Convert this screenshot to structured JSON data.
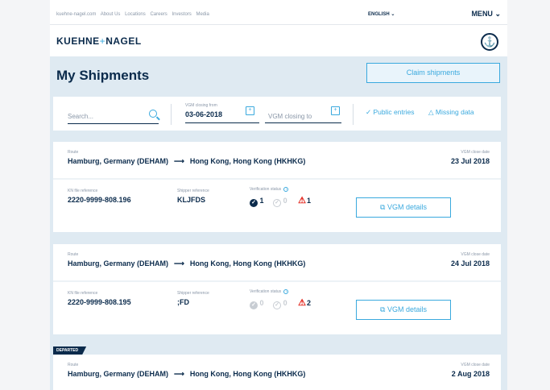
{
  "topbar": {
    "links": [
      "kuehne-nagel.com",
      "About Us",
      "Locations",
      "Careers",
      "Investors",
      "Media"
    ],
    "language": "ENGLISH",
    "menu": "MENU"
  },
  "brand": {
    "left": "KUEHNE",
    "plus": "+",
    "right": "NAGEL",
    "icon": "anchor-icon"
  },
  "page": {
    "title": "My Shipments",
    "claim_button": "Claim shipments"
  },
  "filters": {
    "search_placeholder": "Search...",
    "vgm_from_label": "VGM closing from",
    "vgm_from_value": "03-06-2018",
    "vgm_to_placeholder": "VGM closing to",
    "public_entries": "Public entries",
    "missing_data": "Missing data"
  },
  "labels": {
    "route": "Route",
    "vgm_close_date": "VGM close date",
    "kn_ref": "KN file reference",
    "shipper_ref": "Shipper reference",
    "verification": "Verification status",
    "vgm_details": "VGM details",
    "departed": "DEPARTED"
  },
  "shipments": [
    {
      "origin": "Hamburg, Germany (DEHAM)",
      "destination": "Hong Kong, Hong Kong (HKHKG)",
      "vgm_close_date": "23 Jul 2018",
      "kn_ref": "2220-9999-808.196",
      "shipper_ref": "KLJFDS",
      "verified": "1",
      "pending": "0",
      "warnings": "1"
    },
    {
      "origin": "Hamburg, Germany (DEHAM)",
      "destination": "Hong Kong, Hong Kong (HKHKG)",
      "vgm_close_date": "24 Jul 2018",
      "kn_ref": "2220-9999-808.195",
      "shipper_ref": ";FD",
      "verified": "0",
      "pending": "0",
      "warnings": "2"
    },
    {
      "origin": "Hamburg, Germany (DEHAM)",
      "destination": "Hong Kong, Hong Kong (HKHKG)",
      "vgm_close_date": "2 Aug 2018"
    }
  ]
}
